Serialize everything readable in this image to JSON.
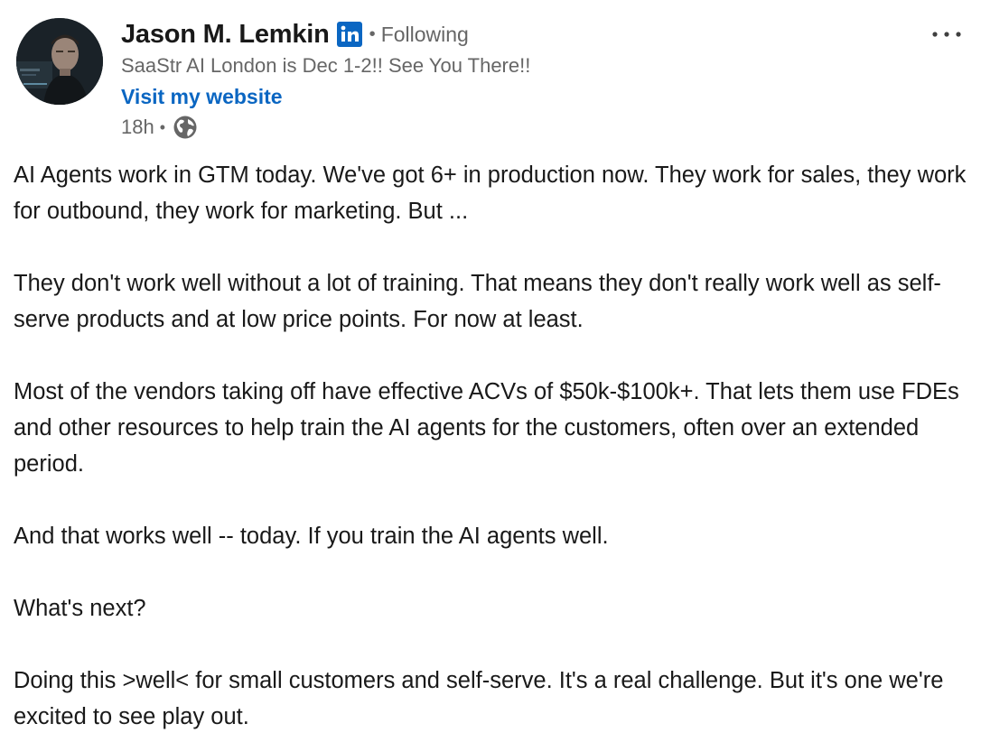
{
  "author": {
    "name": "Jason M. Lemkin",
    "connection": "Following",
    "headline": "SaaStr AI London is Dec 1-2!! See You There!!",
    "link_label": "Visit my website",
    "time": "18h",
    "visibility_icon": "globe-icon",
    "badge_icon": "linkedin-icon",
    "avatar_icon": "avatar"
  },
  "menu": {
    "icon": "more-options-icon"
  },
  "post": {
    "paragraphs": [
      "AI Agents work in GTM today. We've got 6+ in production now. They work for sales, they work for outbound, they work for marketing. But ...",
      "They don't work well without a lot of training. That means they don't really work well as self-serve products and at low price points. For now at least.",
      "Most of the vendors taking off have effective ACVs of $50k-$100k+. That lets them use FDEs and other resources to help train the AI agents for the customers, often over an extended period.",
      "And that works well -- today. If you train the AI agents well.",
      "What's next?",
      "Doing this >well< for small customers and self-serve. It's a real challenge. But it's one we're excited to see play out."
    ]
  },
  "colors": {
    "link": "#0a66c2",
    "secondary_text": "#666666",
    "primary_text": "#191919",
    "linkedin_blue": "#0a66c2"
  }
}
